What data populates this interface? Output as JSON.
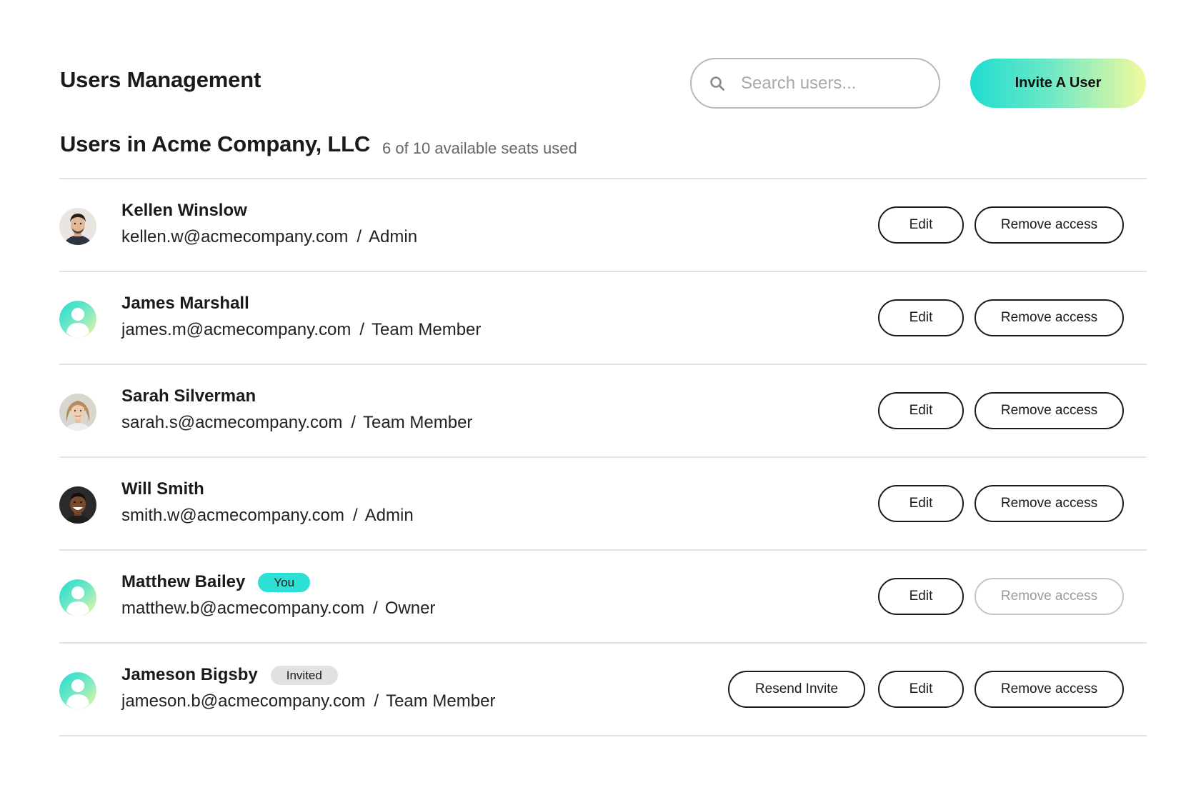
{
  "header": {
    "title": "Users Management",
    "search": {
      "placeholder": "Search users...",
      "value": ""
    },
    "invite_label": "Invite A User"
  },
  "section": {
    "title": "Users in Acme Company, LLC",
    "seats_text": "6 of 10 available seats used"
  },
  "actions": {
    "edit_label": "Edit",
    "remove_label": "Remove access",
    "resend_label": "Resend Invite"
  },
  "users": [
    {
      "name": "Kellen Winslow",
      "email": "kellen.w@acmecompany.com",
      "role": "Admin",
      "avatar": "photo-man-beard",
      "badge": "",
      "remove_enabled": true
    },
    {
      "name": "James Marshall",
      "email": "james.m@acmecompany.com",
      "role": "Team Member",
      "avatar": "default-user-icon",
      "badge": "",
      "remove_enabled": true
    },
    {
      "name": "Sarah Silverman",
      "email": "sarah.s@acmecompany.com",
      "role": "Team Member",
      "avatar": "photo-woman-blonde",
      "badge": "",
      "remove_enabled": true
    },
    {
      "name": "Will Smith",
      "email": "smith.w@acmecompany.com",
      "role": "Admin",
      "avatar": "photo-man-smiling",
      "badge": "",
      "remove_enabled": true
    },
    {
      "name": "Matthew Bailey",
      "email": "matthew.b@acmecompany.com",
      "role": "Owner",
      "avatar": "default-user-icon",
      "badge": "You",
      "remove_enabled": false
    },
    {
      "name": "Jameson Bigsby",
      "email": "jameson.b@acmecompany.com",
      "role": "Team Member",
      "avatar": "default-user-icon",
      "badge": "Invited",
      "remove_enabled": true
    }
  ],
  "colors": {
    "accent_teal": "#2ce0d4",
    "gradient_start": "#1fdcd0",
    "gradient_end": "#f3f99e",
    "badge_invited_bg": "#e1e1e1",
    "divider": "#e3e3e3"
  }
}
